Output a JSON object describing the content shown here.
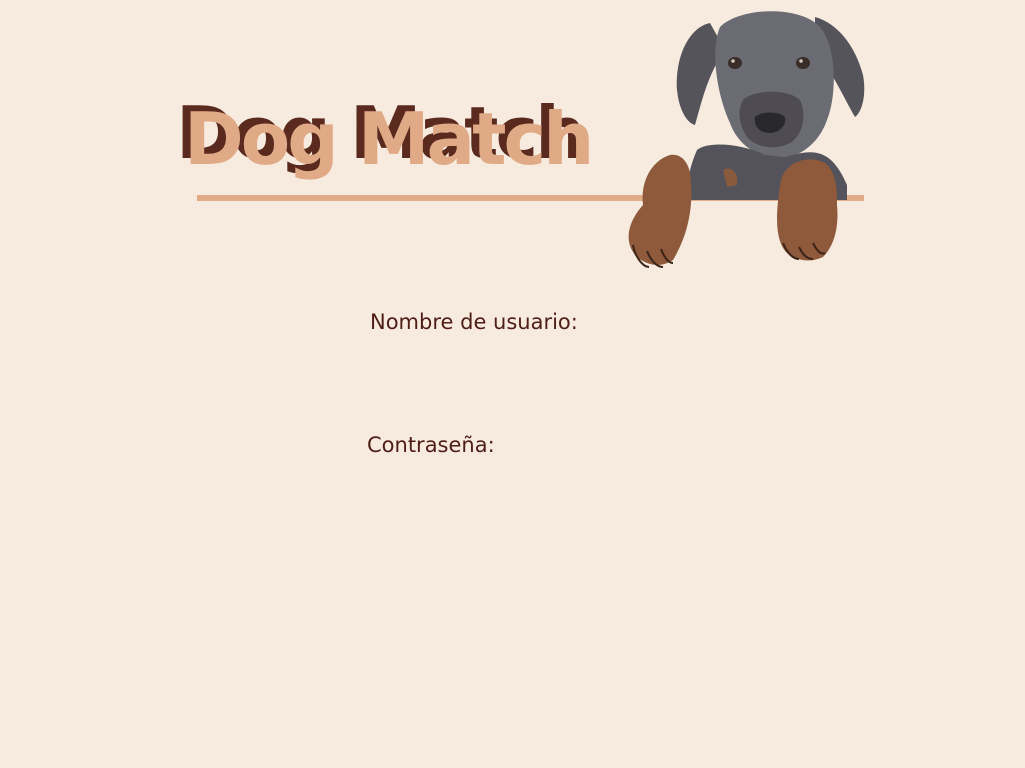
{
  "app": {
    "title": "Dog Match",
    "brand_colors": {
      "background": "#f7ebdf",
      "accent": "#e1aa86",
      "text_dark": "#4f1d17"
    }
  },
  "header": {
    "logo_text": "Dog Match",
    "illustration": "puppy-peeking-over-ledge"
  },
  "form": {
    "username_label": "Nombre de usuario:",
    "username_value": "",
    "password_label": "Contraseña:",
    "password_value": ""
  }
}
